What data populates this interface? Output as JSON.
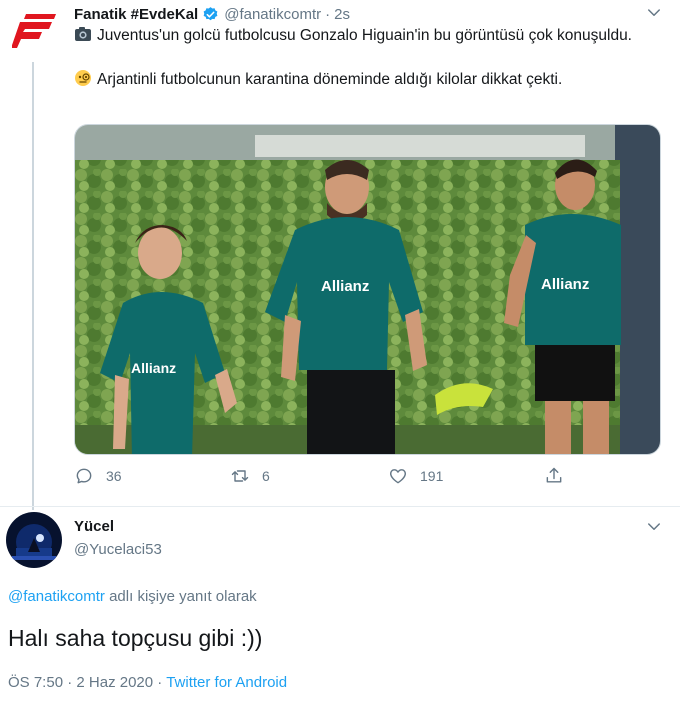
{
  "tweet": {
    "author_name": "Fanatik #EvdeKal",
    "handle": "@fanatikcomtr",
    "separator": "·",
    "time": "2s",
    "line1": "Juventus'un golcü futbolcusu Gonzalo Higuain'in bu görüntüsü çok konuşuldu.",
    "line2": "Arjantinli futbolcunun karantina döneminde aldığı kilolar dikkat çekti.",
    "emoji1": "camera-emoji",
    "emoji2": "monocle-face-emoji",
    "media": {
      "jersey_sponsor": "Allianz"
    },
    "replies": "36",
    "retweets": "6",
    "likes": "191"
  },
  "reply": {
    "author_name": "Yücel",
    "handle": "@Yucelaci53",
    "reply_to_mention": "@fanatikcomtr",
    "reply_to_suffix": " adlı kişiye yanıt olarak",
    "text": "Halı saha topçusu gibi :))",
    "time": "ÖS 7:50",
    "date": "2 Haz 2020",
    "separator": "·",
    "source": "Twitter for Android"
  },
  "colors": {
    "brand_red": "#e0161f",
    "link_blue": "#1da1f2",
    "verified_blue": "#1da1f2",
    "secondary_gray": "#657786",
    "jersey_teal": "#0e6b6a"
  }
}
